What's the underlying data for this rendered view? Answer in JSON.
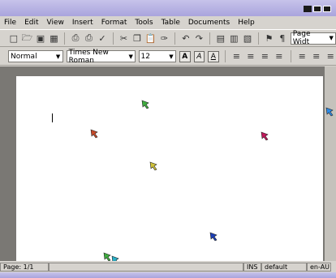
{
  "menu": [
    "File",
    "Edit",
    "View",
    "Insert",
    "Format",
    "Tools",
    "Table",
    "Documents",
    "Help"
  ],
  "toolbar": {
    "zoom_value": "Page Widt"
  },
  "format": {
    "style_value": "Normal",
    "font_value": "Times New Roman",
    "size_value": "12",
    "btn_a1": "A",
    "btn_a2": "A",
    "btn_a3": "A"
  },
  "status": {
    "page": "Page: 1/1",
    "mode": "INS",
    "style": "default",
    "lang": "en-AU"
  },
  "pointer_colors": [
    "#3fae3f",
    "#c64a2a",
    "#d0c23a",
    "#c2185b",
    "#1c3fb8",
    "#2e8be6",
    "#3fae3f",
    "#28b0c8",
    "#e07a2a"
  ]
}
